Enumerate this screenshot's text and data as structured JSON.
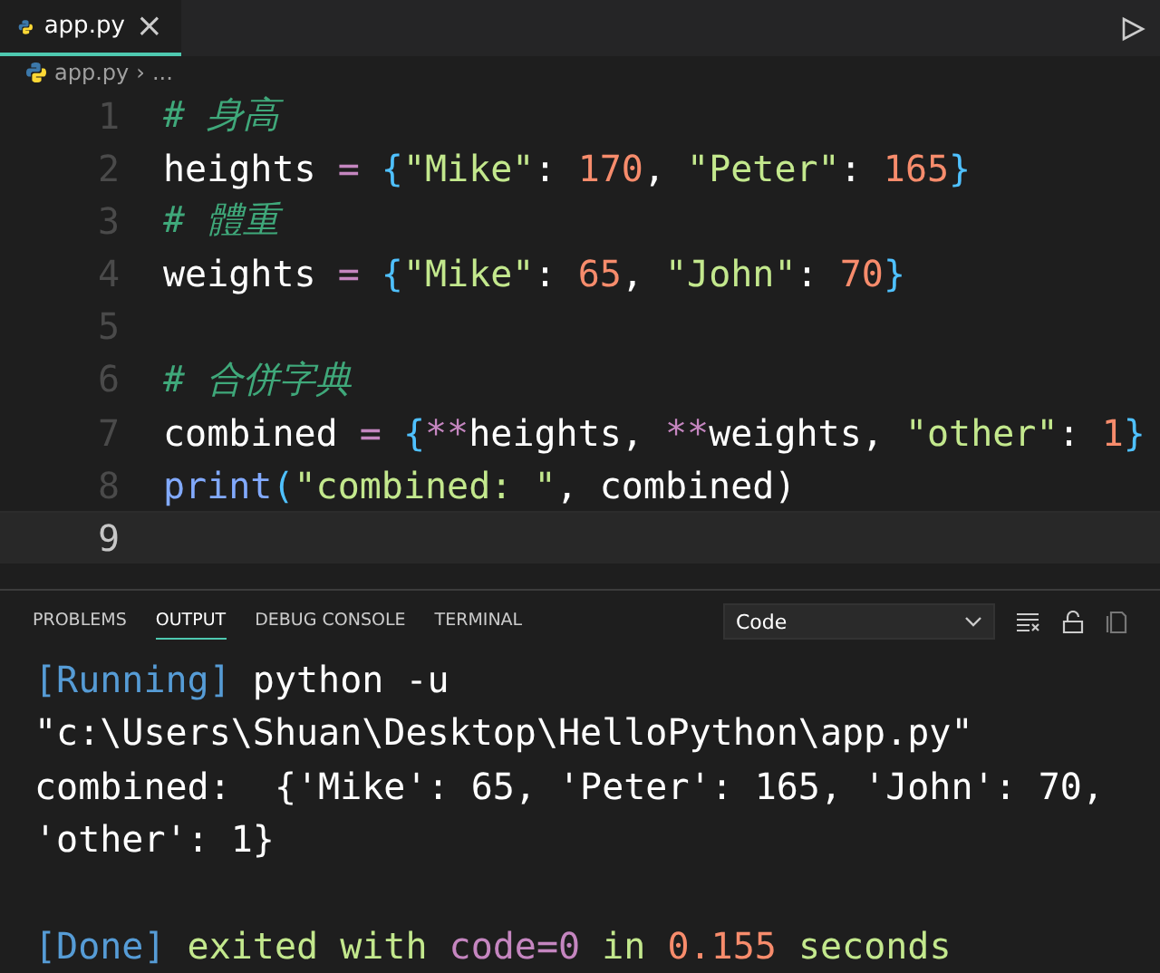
{
  "tabs": [
    {
      "label": "app.py",
      "selected": true,
      "close": "×"
    }
  ],
  "breadcrumb": {
    "file": "app.py",
    "separator": "›",
    "rest": "..."
  },
  "editor": {
    "lines": [
      {
        "number": "1",
        "current": false,
        "tokens": [
          {
            "text": "# 身高",
            "kind": "comment"
          }
        ]
      },
      {
        "number": "2",
        "current": false,
        "tokens": [
          {
            "text": "heights ",
            "kind": "name"
          },
          {
            "text": "=",
            "kind": "op"
          },
          {
            "text": " {",
            "kind": "brace"
          },
          {
            "text": "\"Mike\"",
            "kind": "string"
          },
          {
            "text": ": ",
            "kind": "name"
          },
          {
            "text": "170",
            "kind": "number"
          },
          {
            "text": ", ",
            "kind": "name"
          },
          {
            "text": "\"Peter\"",
            "kind": "string"
          },
          {
            "text": ": ",
            "kind": "name"
          },
          {
            "text": "165",
            "kind": "number"
          },
          {
            "text": "}",
            "kind": "brace"
          }
        ]
      },
      {
        "number": "3",
        "current": false,
        "tokens": [
          {
            "text": "# 體重",
            "kind": "comment"
          }
        ]
      },
      {
        "number": "4",
        "current": false,
        "tokens": [
          {
            "text": "weights ",
            "kind": "name"
          },
          {
            "text": "=",
            "kind": "op"
          },
          {
            "text": " {",
            "kind": "brace"
          },
          {
            "text": "\"Mike\"",
            "kind": "string"
          },
          {
            "text": ": ",
            "kind": "name"
          },
          {
            "text": "65",
            "kind": "number"
          },
          {
            "text": ", ",
            "kind": "name"
          },
          {
            "text": "\"John\"",
            "kind": "string"
          },
          {
            "text": ": ",
            "kind": "name"
          },
          {
            "text": "70",
            "kind": "number"
          },
          {
            "text": "}",
            "kind": "brace"
          }
        ]
      },
      {
        "number": "5",
        "current": false
      },
      {
        "number": "6",
        "current": false,
        "tokens": [
          {
            "text": "# 合併字典",
            "kind": "comment"
          }
        ]
      },
      {
        "number": "7",
        "current": false,
        "tokens": [
          {
            "text": "combined ",
            "kind": "name"
          },
          {
            "text": "=",
            "kind": "op"
          },
          {
            "text": " {",
            "kind": "brace"
          },
          {
            "text": "**",
            "kind": "op"
          },
          {
            "text": "heights, ",
            "kind": "name"
          },
          {
            "text": "**",
            "kind": "op"
          },
          {
            "text": "weights, ",
            "kind": "name"
          },
          {
            "text": "\"other\"",
            "kind": "string"
          },
          {
            "text": ": ",
            "kind": "name"
          },
          {
            "text": "1",
            "kind": "number"
          },
          {
            "text": "}",
            "kind": "brace"
          }
        ]
      },
      {
        "number": "8",
        "current": false,
        "tokens": [
          {
            "text": "print",
            "kind": "func"
          },
          {
            "text": "(",
            "kind": "brace"
          },
          {
            "text": "\"combined: \"",
            "kind": "string"
          },
          {
            "text": ", combined)",
            "kind": "name"
          }
        ]
      },
      {
        "number": "9",
        "current": true
      }
    ]
  },
  "panel": {
    "tabs": [
      {
        "label": "PROBLEMS",
        "selected": false
      },
      {
        "label": "OUTPUT",
        "selected": true
      },
      {
        "label": "DEBUG CONSOLE",
        "selected": false
      },
      {
        "label": "TERMINAL",
        "selected": false
      }
    ],
    "channel": "Code",
    "output": [
      {
        "kind": "text",
        "tokens": [
          {
            "text": "[Running]",
            "kind": "tag"
          },
          {
            "text": " python -u",
            "kind": "plain"
          }
        ]
      },
      {
        "kind": "text",
        "tokens": [
          {
            "text": "\"c:\\Users\\Shuan\\Desktop\\HelloPython\\app.py\"",
            "kind": "plain"
          }
        ]
      },
      {
        "kind": "text",
        "tokens": [
          {
            "text": "combined:  {'Mike': 65, 'Peter': 165, 'John': 70,",
            "kind": "plain"
          }
        ]
      },
      {
        "kind": "text",
        "tokens": [
          {
            "text": "'other': 1}",
            "kind": "plain"
          }
        ]
      },
      {
        "kind": "blank"
      },
      {
        "kind": "text",
        "tokens": [
          {
            "text": "[Done]",
            "kind": "tag"
          },
          {
            "text": " exited with ",
            "kind": "green"
          },
          {
            "text": "code=0",
            "kind": "purple"
          },
          {
            "text": " in ",
            "kind": "green"
          },
          {
            "text": "0.155",
            "kind": "number"
          },
          {
            "text": " seconds",
            "kind": "green"
          }
        ]
      }
    ]
  }
}
